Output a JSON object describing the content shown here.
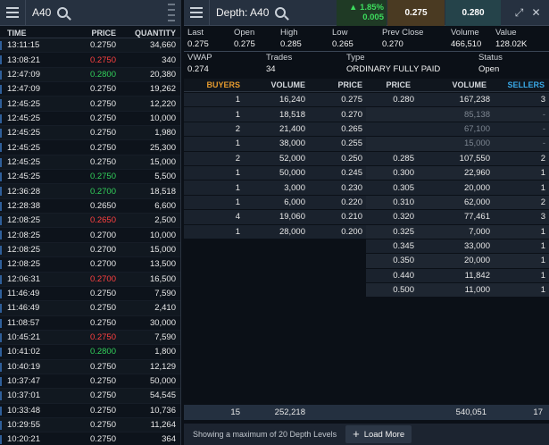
{
  "cos": {
    "title": "A40",
    "columns": {
      "time": "TIME",
      "price": "PRICE",
      "quantity": "QUANTITY"
    },
    "rows": [
      {
        "time": "13:11:15",
        "price": "0.2750",
        "qty": "34,660",
        "dir": ""
      },
      {
        "time": "13:08:21",
        "price": "0.2750",
        "qty": "340",
        "dir": "down"
      },
      {
        "time": "12:47:09",
        "price": "0.2800",
        "qty": "20,380",
        "dir": "up"
      },
      {
        "time": "12:47:09",
        "price": "0.2750",
        "qty": "19,262",
        "dir": ""
      },
      {
        "time": "12:45:25",
        "price": "0.2750",
        "qty": "12,220",
        "dir": ""
      },
      {
        "time": "12:45:25",
        "price": "0.2750",
        "qty": "10,000",
        "dir": ""
      },
      {
        "time": "12:45:25",
        "price": "0.2750",
        "qty": "1,980",
        "dir": ""
      },
      {
        "time": "12:45:25",
        "price": "0.2750",
        "qty": "25,300",
        "dir": ""
      },
      {
        "time": "12:45:25",
        "price": "0.2750",
        "qty": "15,000",
        "dir": ""
      },
      {
        "time": "12:45:25",
        "price": "0.2750",
        "qty": "5,500",
        "dir": "up"
      },
      {
        "time": "12:36:28",
        "price": "0.2700",
        "qty": "18,518",
        "dir": "up"
      },
      {
        "time": "12:28:38",
        "price": "0.2650",
        "qty": "6,600",
        "dir": ""
      },
      {
        "time": "12:08:25",
        "price": "0.2650",
        "qty": "2,500",
        "dir": "down"
      },
      {
        "time": "12:08:25",
        "price": "0.2700",
        "qty": "10,000",
        "dir": ""
      },
      {
        "time": "12:08:25",
        "price": "0.2700",
        "qty": "15,000",
        "dir": ""
      },
      {
        "time": "12:08:25",
        "price": "0.2700",
        "qty": "13,500",
        "dir": ""
      },
      {
        "time": "12:06:31",
        "price": "0.2700",
        "qty": "16,500",
        "dir": "down"
      },
      {
        "time": "11:46:49",
        "price": "0.2750",
        "qty": "7,590",
        "dir": ""
      },
      {
        "time": "11:46:49",
        "price": "0.2750",
        "qty": "2,410",
        "dir": ""
      },
      {
        "time": "11:08:57",
        "price": "0.2750",
        "qty": "30,000",
        "dir": ""
      },
      {
        "time": "10:45:21",
        "price": "0.2750",
        "qty": "7,590",
        "dir": "down"
      },
      {
        "time": "10:41:02",
        "price": "0.2800",
        "qty": "1,800",
        "dir": "up"
      },
      {
        "time": "10:40:19",
        "price": "0.2750",
        "qty": "12,129",
        "dir": ""
      },
      {
        "time": "10:37:47",
        "price": "0.2750",
        "qty": "50,000",
        "dir": ""
      },
      {
        "time": "10:37:01",
        "price": "0.2750",
        "qty": "54,545",
        "dir": ""
      },
      {
        "time": "10:33:48",
        "price": "0.2750",
        "qty": "10,736",
        "dir": ""
      },
      {
        "time": "10:29:55",
        "price": "0.2750",
        "qty": "11,264",
        "dir": ""
      },
      {
        "time": "10:20:21",
        "price": "0.2750",
        "qty": "364",
        "dir": ""
      }
    ]
  },
  "depth": {
    "title": "Depth: A40",
    "change_pct": "1.85%",
    "change_abs": "0.005",
    "bid": "0.275",
    "ask": "0.280",
    "quote_labels": [
      "Last",
      "Open",
      "High",
      "Low",
      "Prev Close",
      "Volume",
      "Value"
    ],
    "quote_values": [
      "0.275",
      "0.275",
      "0.285",
      "0.265",
      "0.270",
      "466,510",
      "128.02K"
    ],
    "info_labels": [
      "VWAP",
      "Trades",
      "Type",
      "Status"
    ],
    "info_values": [
      "0.274",
      "34",
      "ORDINARY FULLY PAID",
      "Open"
    ],
    "columns": {
      "buyers": "BUYERS",
      "volume": "VOLUME",
      "price": "PRICE",
      "sellers": "SELLERS"
    },
    "bids": [
      {
        "n": "1",
        "vol": "16,240",
        "price": "0.275"
      },
      {
        "n": "1",
        "vol": "18,518",
        "price": "0.270"
      },
      {
        "n": "2",
        "vol": "21,400",
        "price": "0.265"
      },
      {
        "n": "1",
        "vol": "38,000",
        "price": "0.255"
      },
      {
        "n": "2",
        "vol": "52,000",
        "price": "0.250"
      },
      {
        "n": "1",
        "vol": "50,000",
        "price": "0.245"
      },
      {
        "n": "1",
        "vol": "3,000",
        "price": "0.230"
      },
      {
        "n": "1",
        "vol": "6,000",
        "price": "0.220"
      },
      {
        "n": "4",
        "vol": "19,060",
        "price": "0.210"
      },
      {
        "n": "1",
        "vol": "28,000",
        "price": "0.200"
      }
    ],
    "asks": [
      {
        "price": "0.280",
        "vol": "167,238",
        "n": "3",
        "muted": false
      },
      {
        "price": "",
        "vol": "85,138",
        "n": "-",
        "muted": true
      },
      {
        "price": "",
        "vol": "67,100",
        "n": "-",
        "muted": true
      },
      {
        "price": "",
        "vol": "15,000",
        "n": "-",
        "muted": true
      },
      {
        "price": "0.285",
        "vol": "107,550",
        "n": "2",
        "muted": false
      },
      {
        "price": "0.300",
        "vol": "22,960",
        "n": "1",
        "muted": false
      },
      {
        "price": "0.305",
        "vol": "20,000",
        "n": "1",
        "muted": false
      },
      {
        "price": "0.310",
        "vol": "62,000",
        "n": "2",
        "muted": false
      },
      {
        "price": "0.320",
        "vol": "77,461",
        "n": "3",
        "muted": false
      },
      {
        "price": "0.325",
        "vol": "7,000",
        "n": "1",
        "muted": false
      },
      {
        "price": "0.345",
        "vol": "33,000",
        "n": "1",
        "muted": false
      },
      {
        "price": "0.350",
        "vol": "20,000",
        "n": "1",
        "muted": false
      },
      {
        "price": "0.440",
        "vol": "11,842",
        "n": "1",
        "muted": false
      },
      {
        "price": "0.500",
        "vol": "11,000",
        "n": "1",
        "muted": false
      }
    ],
    "totals": {
      "buyers": "15",
      "bid_volume": "252,218",
      "ask_volume": "540,051",
      "sellers": "17"
    },
    "footer_text": "Showing a maximum of 20 Depth Levels",
    "load_more": "Load More"
  }
}
